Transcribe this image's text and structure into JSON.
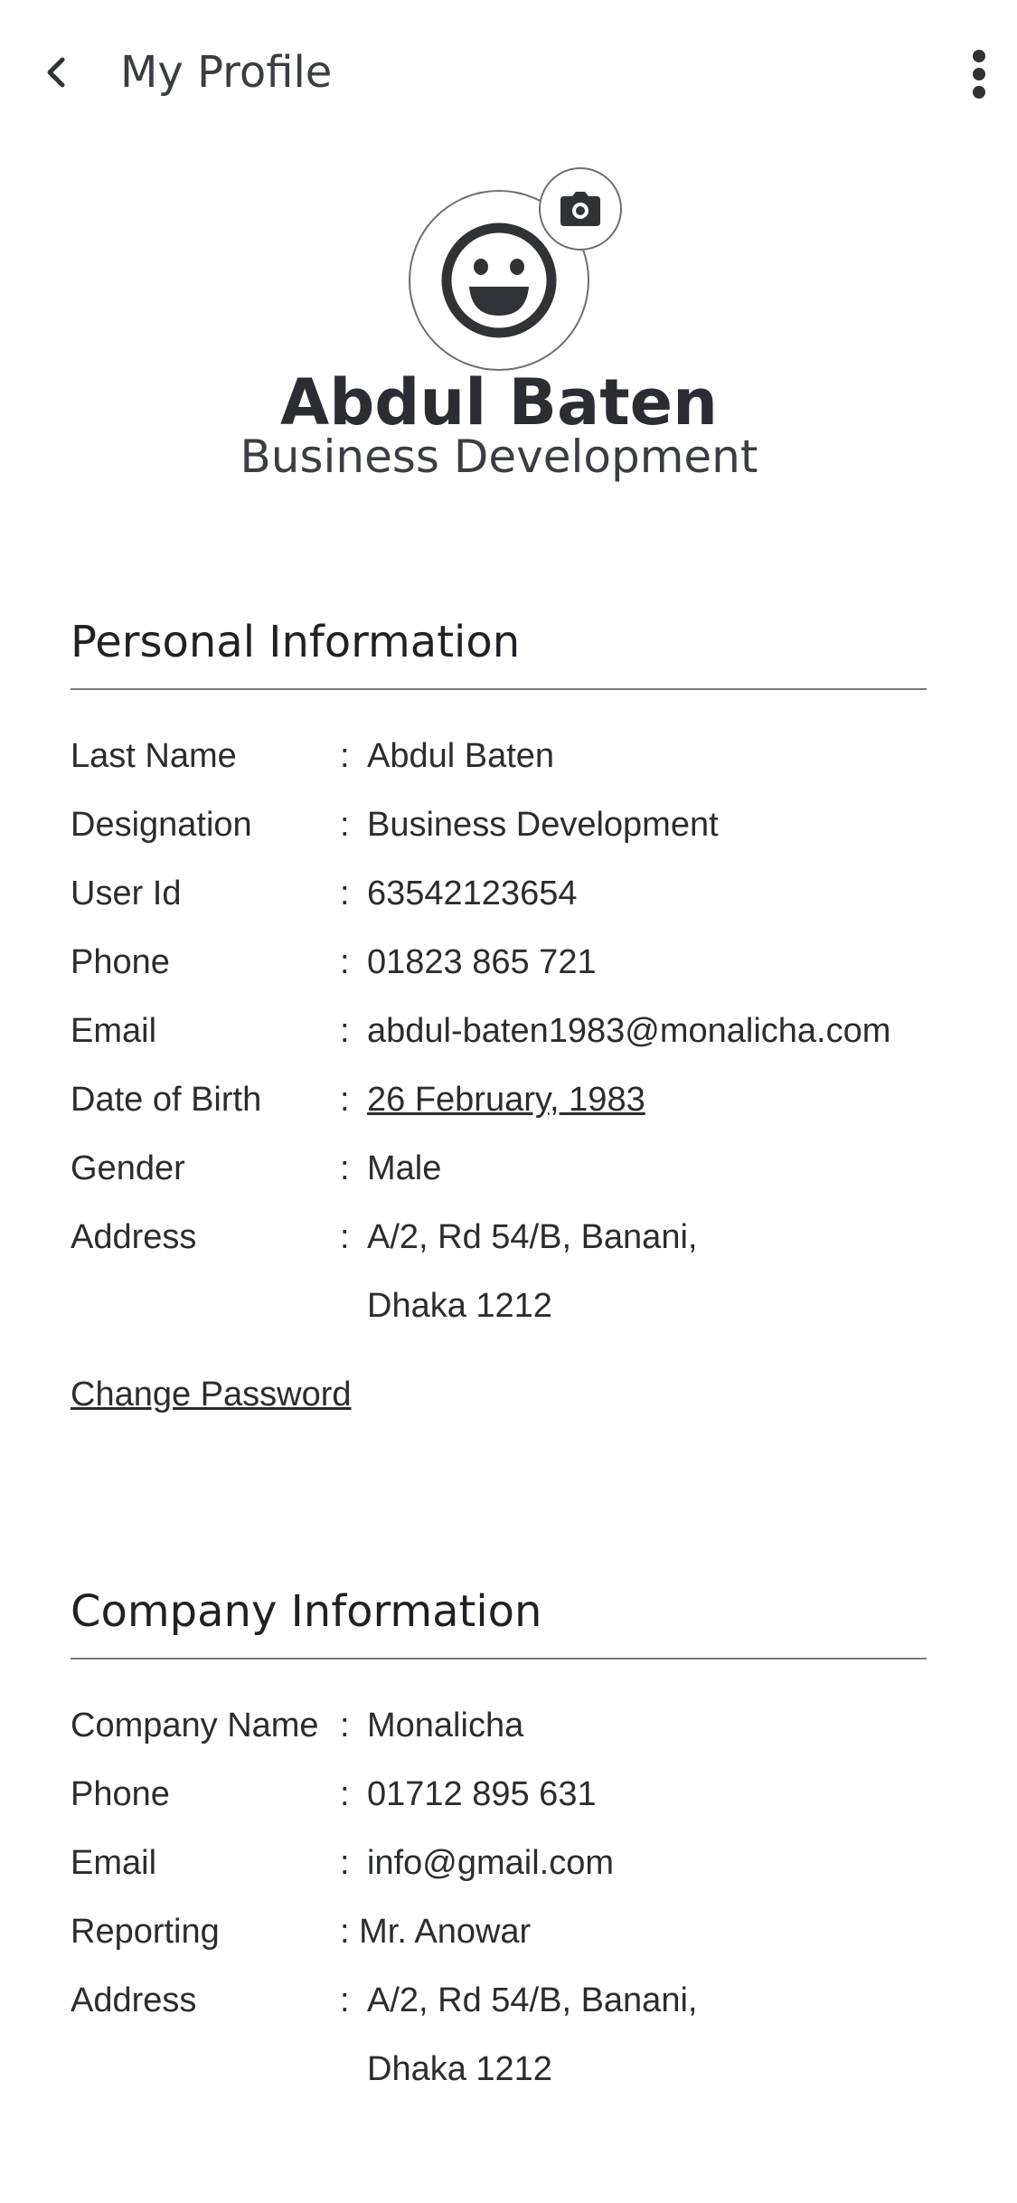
{
  "header": {
    "title": "My Profile",
    "back_icon": "chevron-left-icon",
    "more_icon": "more-vertical-icon"
  },
  "profile": {
    "name": "Abdul Baten",
    "role": "Business Development",
    "avatar_icon": "smiley-face-icon",
    "camera_icon": "camera-icon"
  },
  "personal": {
    "title": "Personal Information",
    "rows": [
      {
        "label": "Last Name",
        "value": "Abdul Baten"
      },
      {
        "label": "Designation",
        "value": "Business Development"
      },
      {
        "label": "User Id",
        "value": "63542123654"
      },
      {
        "label": "Phone",
        "value": "01823 865 721"
      },
      {
        "label": "Email",
        "value": "abdul-baten1983@monalicha.com"
      },
      {
        "label": "Date of Birth",
        "value": "26 February, 1983"
      },
      {
        "label": "Gender",
        "value": "Male"
      },
      {
        "label": "Address",
        "value": "A/2, Rd 54/B, Banani,",
        "value_line2": "Dhaka 1212"
      }
    ],
    "change_password": "Change Password"
  },
  "company": {
    "title": "Company Information",
    "rows": [
      {
        "label": "Company Name",
        "value": "Monalicha"
      },
      {
        "label": "Phone",
        "value": "01712 895 631"
      },
      {
        "label": "Email",
        "value": "info@gmail.com"
      },
      {
        "label": "Reporting",
        "value": ": Mr. Anowar"
      },
      {
        "label": "Address",
        "value": "A/2, Rd 54/B, Banani,",
        "value_line2": "Dhaka 1212"
      }
    ]
  },
  "colors": {
    "text": "#2a2c30",
    "divider": "#7a7a7a",
    "icon": "#2f3237"
  }
}
